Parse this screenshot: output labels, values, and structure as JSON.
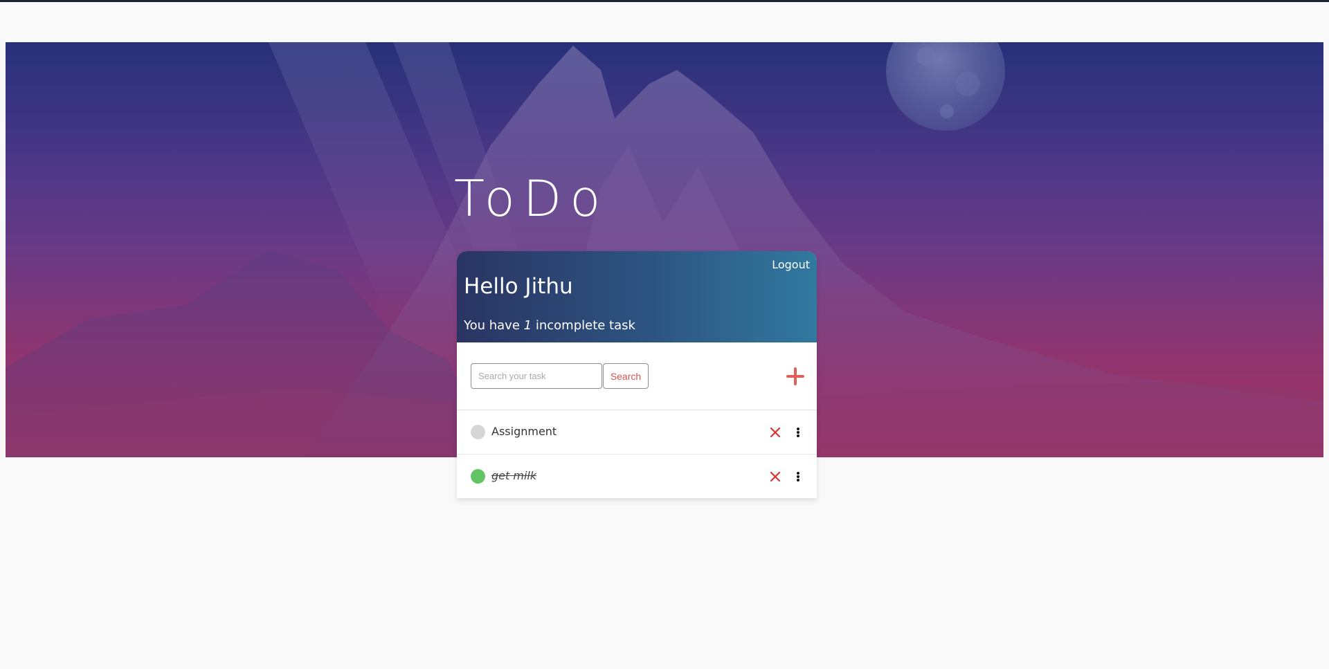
{
  "app": {
    "title": "ToDo"
  },
  "header": {
    "logout_label": "Logout",
    "greeting": "Hello Jithu",
    "summary_prefix": "You have",
    "incomplete_count": "1",
    "summary_suffix": "incomplete task"
  },
  "toolbar": {
    "search_placeholder": "Search your task",
    "search_value": "",
    "search_button_label": "Search",
    "add_icon": "plus-icon"
  },
  "tasks": [
    {
      "label": "Assignment",
      "completed": false,
      "status_color": "#d6d6d6"
    },
    {
      "label": "get milk",
      "completed": true,
      "status_color": "#62c462"
    }
  ],
  "icons": {
    "delete": "close-icon",
    "more": "more-vertical-icon"
  },
  "colors": {
    "accent": "#e0605a",
    "delete": "#d9342f",
    "header_gradient_start": "#2a3462",
    "header_gradient_end": "#31799f",
    "hero_top": "#27307a",
    "hero_bottom": "#a8305c",
    "complete": "#62c462",
    "incomplete": "#d6d6d6"
  }
}
